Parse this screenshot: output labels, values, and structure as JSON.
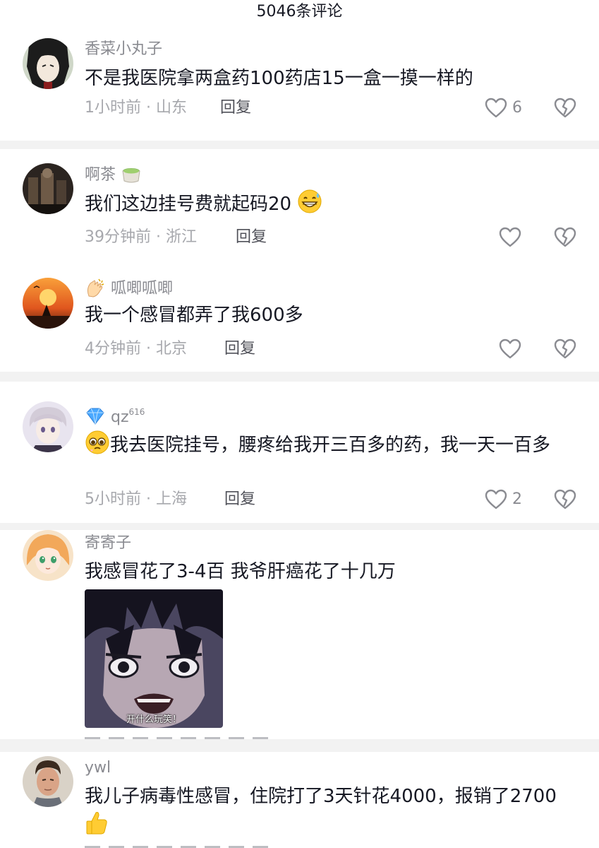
{
  "header": {
    "title": "5046条评论"
  },
  "comments": [
    {
      "username": "香菜小丸子",
      "text": "不是我医院拿两盒药100药店15一盒一摸一样的",
      "meta": "1小时前 · 山东",
      "reply": "回复",
      "likes": "6",
      "avatar_icon": "anime-avatar-icon"
    },
    {
      "username": "啊茶",
      "username_emoji": "tea-cup-emoji",
      "text": "我们这边挂号费就起码20",
      "text_emoji": "grinning-sweat-emoji",
      "meta": "39分钟前 · 浙江",
      "reply": "回复",
      "likes": "",
      "avatar_icon": "dark-photo-avatar-icon"
    },
    {
      "username_prefix_emoji": "clapping-hands-emoji",
      "username": "呱唧呱唧",
      "text": "我一个感冒都弄了我600多",
      "meta": "4分钟前 · 北京",
      "reply": "回复",
      "likes": "",
      "avatar_icon": "sunset-avatar-icon"
    },
    {
      "username_prefix_emoji": "gem-emoji",
      "username": "qz",
      "username_sup": "616",
      "text_emoji": "pleading-face-emoji",
      "text": "我去医院挂号，腰疼给我开三百多的药，我一天一百多",
      "meta": "5小时前 · 上海",
      "reply": "回复",
      "likes": "2",
      "avatar_icon": "anime-boy-avatar-icon"
    },
    {
      "username": "寄寄子",
      "text": "我感冒花了3-4百 我爷肝癌花了十几万",
      "sticker_caption": "开什么玩笑！",
      "avatar_icon": "anime-girl-avatar-icon"
    },
    {
      "username": "ywl",
      "text": "我儿子病毒性感冒，住院打了3天针花4000，报销了2700",
      "text_emoji": "thumbs-up-emoji",
      "avatar_icon": "man-photo-avatar-icon"
    }
  ],
  "colors": {
    "text": "#161823",
    "secondary": "#8a8b91",
    "meta": "#a7a8ad",
    "separator": "#f2f2f2"
  }
}
